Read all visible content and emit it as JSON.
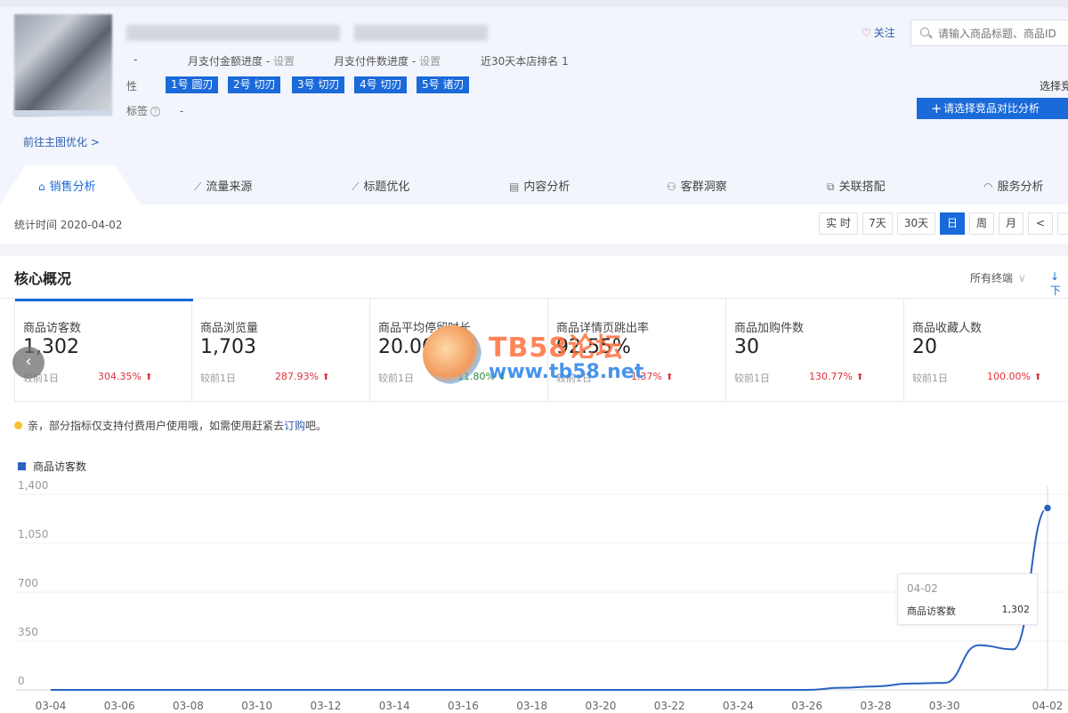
{
  "header": {
    "meta": {
      "pay_amount_label": "月支付金额进度 -",
      "pay_amount_link": "设置",
      "pay_count_label": "月支付件数进度 -",
      "pay_count_link": "设置",
      "rank_text": "近30天本店排名 1",
      "leading_dash": "-"
    },
    "attr_label": "性",
    "tags": [
      "1号 圆刃",
      "2号 切刃",
      "3号 切刃",
      "4号 切刃",
      "5号 诸刃"
    ],
    "label_row": {
      "label": "标签",
      "help_glyph": "?",
      "value": "-"
    },
    "goto_main": "前往主图优化 >",
    "follow": "关注",
    "search_placeholder": "请输入商品标题、商品ID",
    "select_hint": "选择竞",
    "compare_button": "请选择竞品对比分析"
  },
  "tabs": [
    {
      "label": "销售分析",
      "icon": "bag-icon",
      "glyph": "⌂",
      "active": true
    },
    {
      "label": "流量来源",
      "icon": "trend-icon",
      "glyph": "⟋",
      "active": false
    },
    {
      "label": "标题优化",
      "icon": "trend-icon",
      "glyph": "⟋",
      "active": false
    },
    {
      "label": "内容分析",
      "icon": "document-icon",
      "glyph": "▤",
      "active": false
    },
    {
      "label": "客群洞察",
      "icon": "people-icon",
      "glyph": "⚇",
      "active": false
    },
    {
      "label": "关联搭配",
      "icon": "link-icon",
      "glyph": "⧉",
      "active": false
    },
    {
      "label": "服务分析",
      "icon": "headset-icon",
      "glyph": "◠",
      "active": false
    }
  ],
  "stat_time": "统计时间 2020-04-02",
  "periods": [
    {
      "label": "实 时",
      "active": false
    },
    {
      "label": "7天",
      "active": false
    },
    {
      "label": "30天",
      "active": false
    },
    {
      "label": "日",
      "active": true
    },
    {
      "label": "周",
      "active": false
    },
    {
      "label": "月",
      "active": false
    },
    {
      "label": "<",
      "active": false
    }
  ],
  "core": {
    "title": "核心概况",
    "device": "所有终端",
    "download": "↓下"
  },
  "kpis": [
    {
      "name": "商品访客数",
      "value": "1,302",
      "compare": "较前1日",
      "change": "304.35%",
      "dir": "up"
    },
    {
      "name": "商品浏览量",
      "value": "1,703",
      "compare": "较前1日",
      "change": "287.93%",
      "dir": "up"
    },
    {
      "name": "商品平均停留时长",
      "value": "20.00",
      "compare": "较前1日",
      "change": "11.80%",
      "dir": "down"
    },
    {
      "name": "商品详情页跳出率",
      "value": "92.55%",
      "compare": "较前1日",
      "change": "1.37%",
      "dir": "up"
    },
    {
      "name": "商品加购件数",
      "value": "30",
      "compare": "较前1日",
      "change": "130.77%",
      "dir": "up"
    },
    {
      "name": "商品收藏人数",
      "value": "20",
      "compare": "较前1日",
      "change": "100.00%",
      "dir": "up"
    }
  ],
  "notice": {
    "text": "亲，部分指标仅支持付费用户使用哦，如需使用赶紧去",
    "link": "订购",
    "suffix": "吧。"
  },
  "watermark": {
    "line1": "TB58论坛",
    "line2": "www.tb58.net"
  },
  "tooltip": {
    "date": "04-02",
    "key": "商品访客数",
    "value": "1,302"
  },
  "colors": {
    "accent": "#1a6ad9",
    "line": "#2a62c0",
    "up": "#e0303a",
    "down": "#2a8a3a"
  },
  "chart_data": {
    "type": "line",
    "legend": [
      "商品访客数"
    ],
    "x": [
      "03-04",
      "03-05",
      "03-06",
      "03-07",
      "03-08",
      "03-09",
      "03-10",
      "03-11",
      "03-12",
      "03-13",
      "03-14",
      "03-15",
      "03-16",
      "03-17",
      "03-18",
      "03-19",
      "03-20",
      "03-21",
      "03-22",
      "03-23",
      "03-24",
      "03-25",
      "03-26",
      "03-27",
      "03-28",
      "03-29",
      "03-30",
      "03-31",
      "04-01",
      "04-02"
    ],
    "x_tick_labels": [
      "03-04",
      "03-06",
      "03-08",
      "03-10",
      "03-12",
      "03-14",
      "03-16",
      "03-18",
      "03-20",
      "03-22",
      "03-24",
      "03-26",
      "03-28",
      "03-30",
      "04-02"
    ],
    "series": [
      {
        "name": "商品访客数",
        "values": [
          0,
          0,
          0,
          0,
          0,
          0,
          0,
          0,
          0,
          0,
          0,
          0,
          0,
          0,
          0,
          0,
          0,
          0,
          0,
          0,
          0,
          0,
          0,
          15,
          25,
          45,
          50,
          320,
          290,
          1302
        ]
      }
    ],
    "y_ticks": [
      "0",
      "350",
      "700",
      "1,050",
      "1,400"
    ],
    "ylim": [
      0,
      1400
    ],
    "grid": true,
    "highlight_point": "04-02"
  }
}
